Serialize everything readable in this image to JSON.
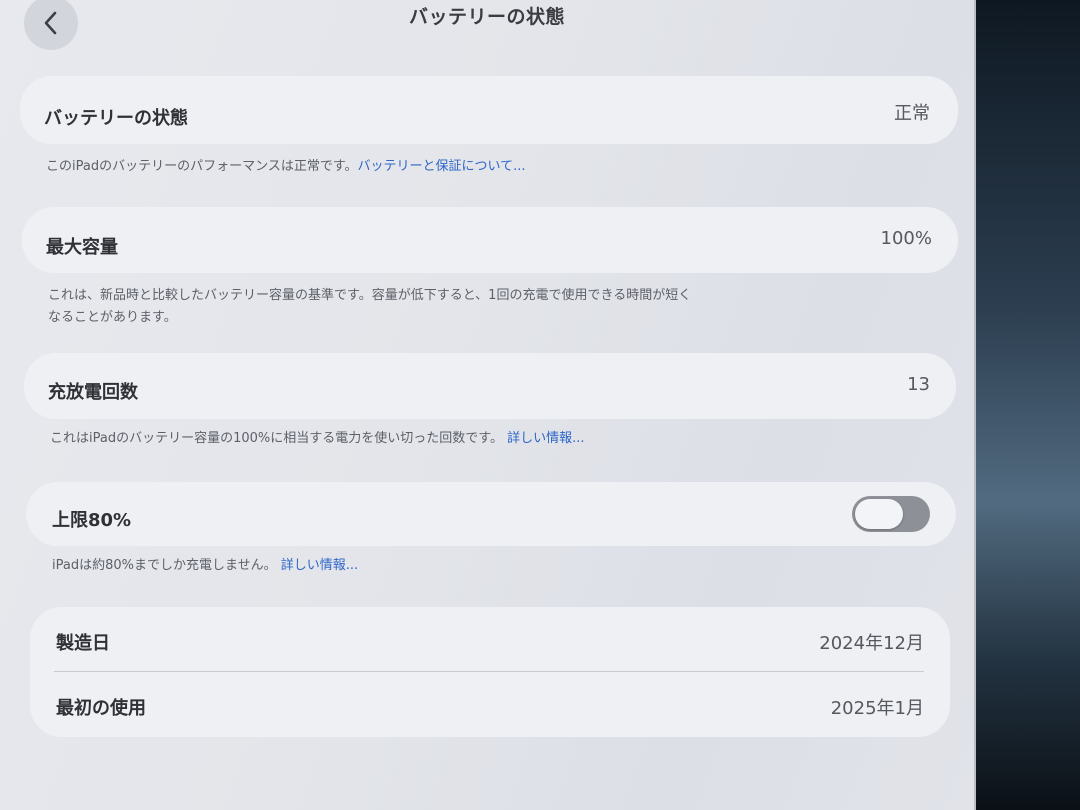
{
  "nav": {
    "title": "バッテリーの状態",
    "back_icon": "chevron-left-icon"
  },
  "battery_health": {
    "label": "バッテリーの状態",
    "value": "正常",
    "note": "このiPadのバッテリーのパフォーマンスは正常です。",
    "link": "バッテリーと保証について..."
  },
  "max_capacity": {
    "label": "最大容量",
    "value": "100%",
    "note_line1": "これは、新品時と比較したバッテリー容量の基準です。容量が低下すると、1回の充電で使用できる時間が短く",
    "note_line2": "なることがあります。"
  },
  "cycle_count": {
    "label": "充放電回数",
    "value": "13",
    "note": "これはiPadのバッテリー容量の100%に相当する電力を使い切った回数です。",
    "link": "詳しい情報..."
  },
  "limit_80": {
    "label": "上限80%",
    "toggle_on": false,
    "note": "iPadは約80%までしか充電しません。",
    "link": "詳しい情報..."
  },
  "dates": {
    "manufacture_label": "製造日",
    "manufacture_value": "2024年12月",
    "first_use_label": "最初の使用",
    "first_use_value": "2025年1月"
  },
  "colors": {
    "link": "#2f66c8",
    "toggle_off": "#8e9097"
  }
}
